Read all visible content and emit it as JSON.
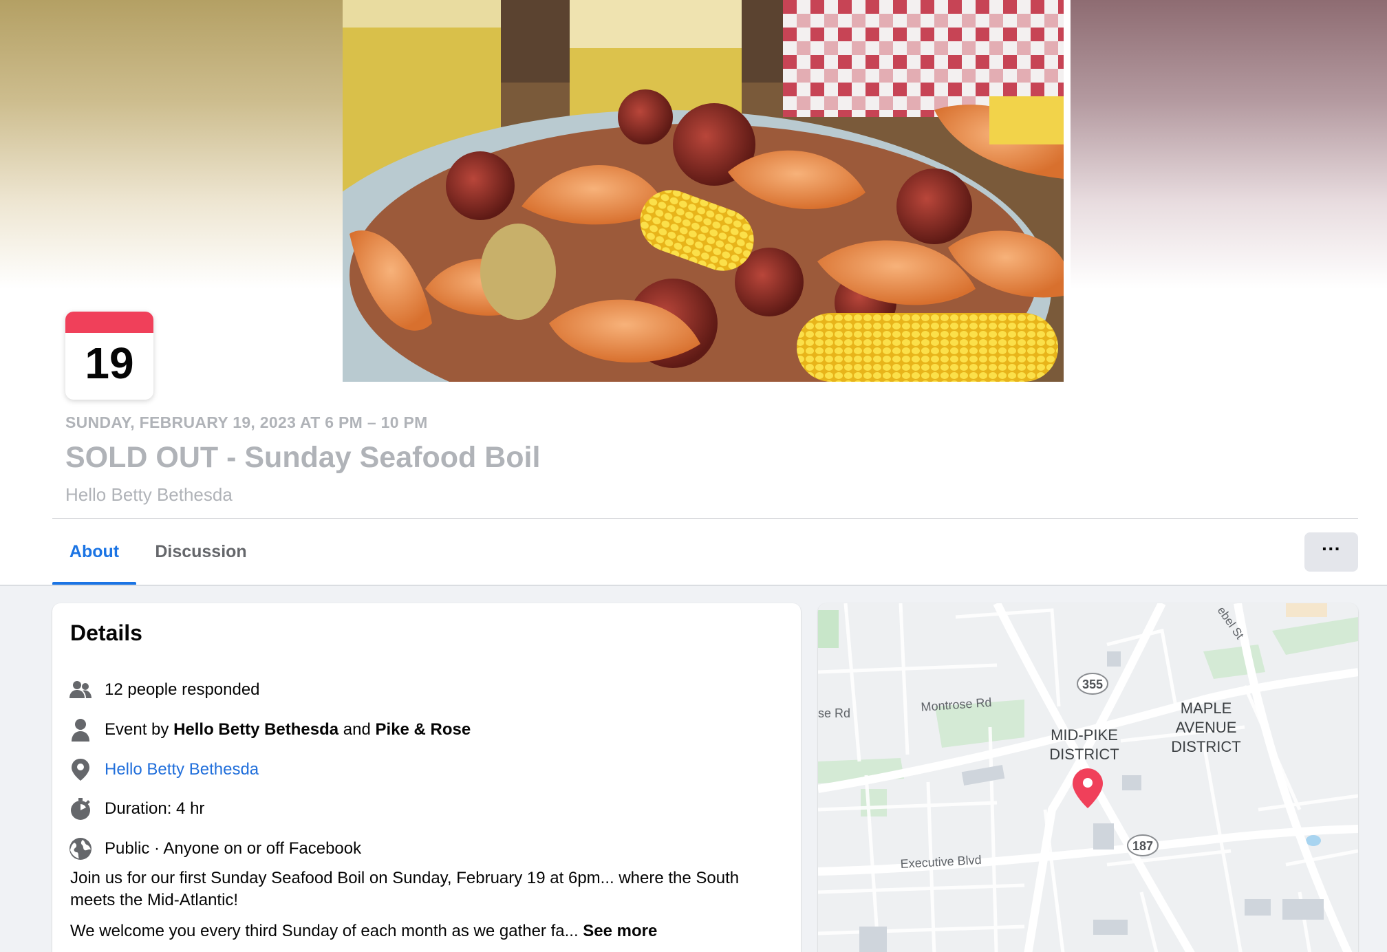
{
  "event": {
    "day": "19",
    "date_line": "SUNDAY, FEBRUARY 19, 2023 AT 6 PM – 10 PM",
    "title": "SOLD OUT - Sunday Seafood Boil",
    "host": "Hello Betty Bethesda"
  },
  "tabs": [
    {
      "label": "About",
      "active": true
    },
    {
      "label": "Discussion",
      "active": false
    }
  ],
  "more_button": "···",
  "details": {
    "heading": "Details",
    "responded": "12 people responded",
    "event_by_prefix": "Event by ",
    "event_by_host1": "Hello Betty Bethesda",
    "event_by_and": " and ",
    "event_by_host2": "Pike & Rose",
    "location_link": "Hello Betty Bethesda",
    "duration": "Duration: 4 hr",
    "privacy": "Public · Anyone on or off Facebook",
    "description_1": "Join us for our first Sunday Seafood Boil on Sunday, February 19 at 6pm... where the South meets the Mid-Atlantic!",
    "description_2": "We welcome you every third Sunday of each month as we gather fa... ",
    "see_more": "See more"
  },
  "map": {
    "labels": {
      "montrose": "Montrose Rd",
      "se_rd": "se Rd",
      "executive": "Executive Blvd",
      "mid_pike_1": "MID-PIKE",
      "mid_pike_2": "DISTRICT",
      "maple_1": "MAPLE",
      "maple_2": "AVENUE",
      "maple_3": "DISTRICT",
      "route_355": "355",
      "route_187": "187",
      "hebel": "ebel St"
    },
    "pin_color": "#f0405a"
  },
  "colors": {
    "accent": "#1b74e4",
    "calendar_red": "#f0405a",
    "muted_text": "#b0b3b8",
    "link": "#216fdb"
  },
  "icons": [
    "people-icon",
    "person-icon",
    "location-pin-icon",
    "stopwatch-icon",
    "globe-icon",
    "map-pin-icon"
  ]
}
